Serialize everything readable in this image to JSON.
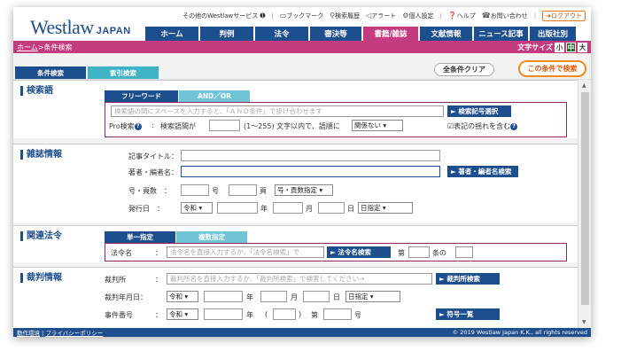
{
  "header": {
    "logo": "Westlaw",
    "logo_suffix": "JAPAN",
    "util": [
      "その他のWestlawサービス",
      "ブックマーク",
      "検索履歴",
      "アラート",
      "個人設定",
      "ヘルプ",
      "お問い合わせ"
    ],
    "logout": "ログアウト",
    "tabs": [
      "ホーム",
      "判例",
      "法令",
      "審決等",
      "書籍/雑誌",
      "文献情報",
      "ニュース記事",
      "出版社別"
    ],
    "active_tab": "書籍/雑誌"
  },
  "breadcrumb": {
    "home": "ホーム",
    "sep": " > ",
    "current": "条件検索"
  },
  "fontsize": {
    "label": "文字サイズ",
    "small": "小",
    "medium": "中",
    "large": "大"
  },
  "searchtabs": {
    "condition": "条件検索",
    "index": "索引検索"
  },
  "actions": {
    "clear": "全条件クリア",
    "search": "この条件で検索"
  },
  "keyword": {
    "heading": "検索語",
    "tab_free": "フリーワード",
    "tab_andor": "AND／OR",
    "placeholder": "検索語の間にスペースを入力すると、「ＡＮＤ条件」で掛け合わせます",
    "symbol_btn": "► 検索記号選択",
    "pro_label": "Pro検索",
    "pro_colon": ":",
    "pro_text1": "検索語間が",
    "pro_text2": "(1〜255) 文字以内で、語順に",
    "pro_select": "関係ない",
    "fuzzy_label": "表記の揺れを含む"
  },
  "magazine": {
    "heading": "雑誌情報",
    "title_label": "記事タイトル：",
    "author_label": "著者・編者名：",
    "author_btn": "► 著者・編者名検索",
    "page_label": "号・頁数　：",
    "page_go": "号",
    "page_page": "頁",
    "page_select": "号・頁数指定",
    "date_label": "発行日　：",
    "era": "令和",
    "year": "年",
    "month": "月",
    "day": "日",
    "date_select": "日指定"
  },
  "law": {
    "heading": "関連法令",
    "tab_single": "単一指定",
    "tab_multi": "複数指定",
    "name_label": "法令名",
    "colon": "：",
    "placeholder": "法令名を直接入力するか、「法令名検索」で",
    "btn": "► 法令名検索",
    "article": "第",
    "article_suffix": "条の"
  },
  "court": {
    "heading": "裁判情報",
    "court_label": "裁判所",
    "colon": "：",
    "court_placeholder": "裁判所名を直接入力するか、「裁判所検索」で検索してください→",
    "court_btn": "► 裁判所検索",
    "date_label": "裁判年月日：",
    "era": "令和",
    "year": "年",
    "month": "月",
    "day": "日",
    "date_select": "日指定",
    "case_label": "事件番号",
    "paren_open": "(",
    "paren_close": ")",
    "article": "第",
    "number": "号",
    "case_btn": "► 符号一覧"
  },
  "footer": {
    "env": "動作環境",
    "sep": "|",
    "privacy": "プライバシーポリシー",
    "copyright": "© 2019 Westlaw Japan K.K., all rights reserved"
  }
}
